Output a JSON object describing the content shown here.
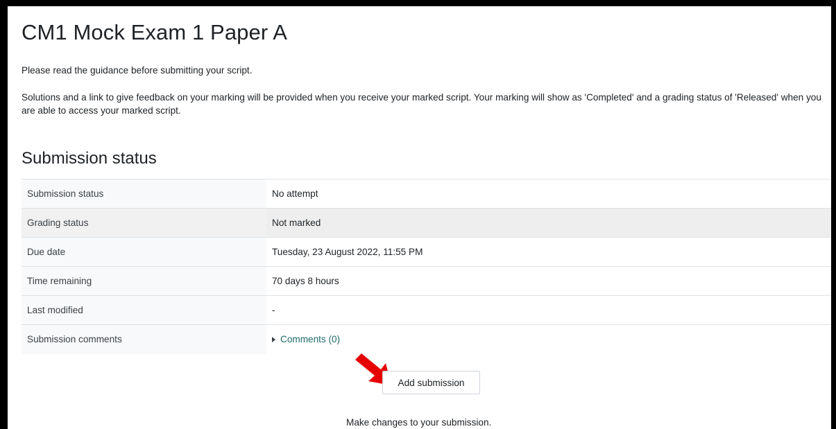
{
  "page": {
    "title": "CM1 Mock Exam 1 Paper A",
    "guidance": "Please read the guidance before submitting your script.",
    "solutions_info": "Solutions and a link to give feedback on your marking will be provided when you receive your marked script.  Your marking will show as 'Completed' and a grading status of 'Released' when you are able to access your marked script."
  },
  "submission": {
    "heading": "Submission status",
    "rows": [
      {
        "label": "Submission status",
        "value": "No attempt"
      },
      {
        "label": "Grading status",
        "value": "Not marked"
      },
      {
        "label": "Due date",
        "value": "Tuesday, 23 August 2022, 11:55 PM"
      },
      {
        "label": "Time remaining",
        "value": "70 days 8 hours"
      },
      {
        "label": "Last modified",
        "value": "-"
      },
      {
        "label": "Submission comments",
        "value": "Comments (0)"
      }
    ]
  },
  "actions": {
    "add_submission_label": "Add submission",
    "help_text": "Make changes to your submission."
  },
  "icons": {
    "comments_toggle": "caret-right-icon",
    "pointer": "red-arrow-icon"
  },
  "colors": {
    "link": "#1f6b6a",
    "annotation_arrow": "#e60000",
    "frame": "#000000"
  }
}
